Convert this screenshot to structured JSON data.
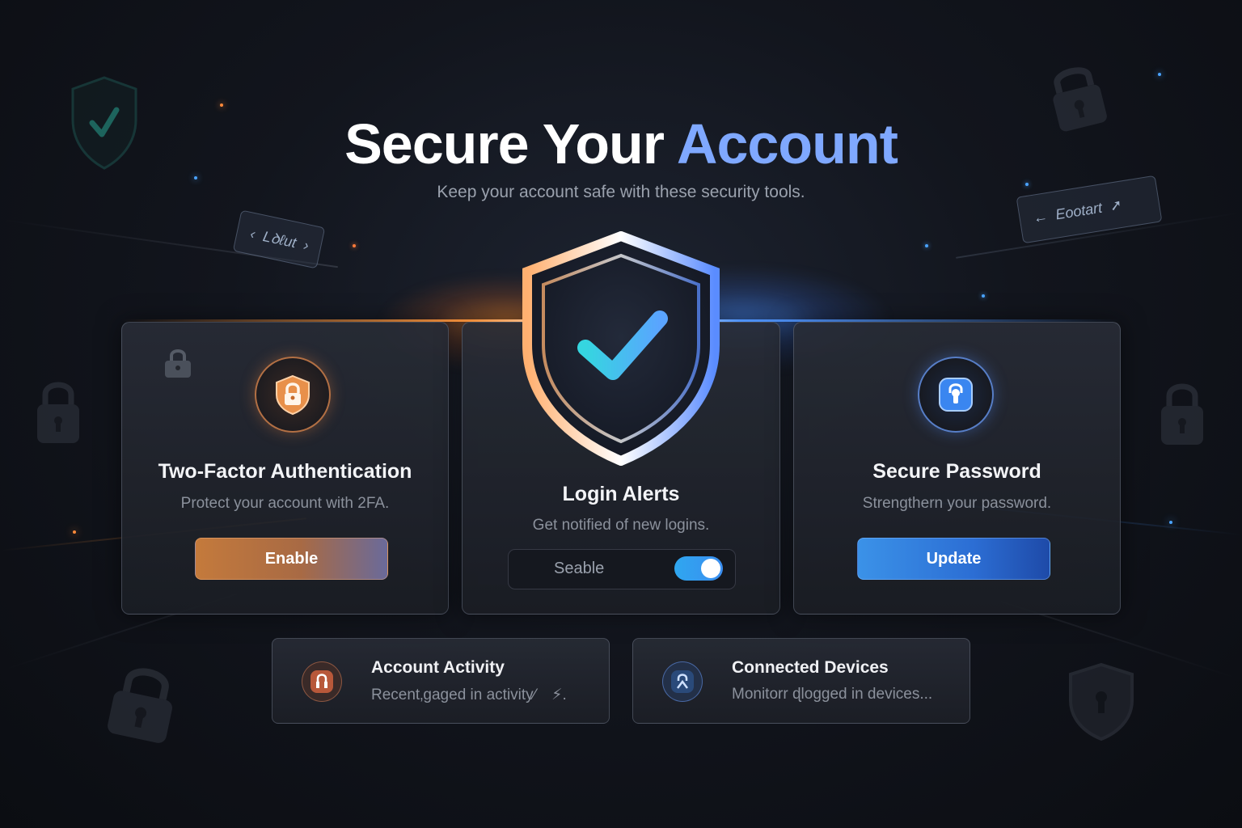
{
  "header": {
    "title_main": "Secure Your",
    "title_accent": "Account",
    "subtitle": "Keep your account safe with these security tools."
  },
  "floating_chips": {
    "left": "Lꝺℓut",
    "right": "Eootart"
  },
  "hero_icon": "shield-check-icon",
  "cards": [
    {
      "icon": "lock-icon",
      "title": "Two-Factor Authentication",
      "description": "Protect your account with 2FA.",
      "button_label": "Enable",
      "accent": "#c47a3c"
    },
    {
      "title": "Login Alerts",
      "description": "Get notified of new logins.",
      "toggle_label": "Seable",
      "toggle_on": true,
      "accent": "#3a8ef0"
    },
    {
      "icon": "keyhole-icon",
      "title": "Secure Password",
      "description": "Strengthern your password.",
      "button_label": "Update",
      "accent": "#2c6ed4"
    }
  ],
  "mini_cards": [
    {
      "icon": "lock-icon",
      "title": "Account Activity",
      "description": "Recent‚ɡaged in activity⁄",
      "trailing": "⚡."
    },
    {
      "icon": "lock-icon",
      "title": "Connected Devices",
      "description": "Monitorr ɖlogged in devices..."
    }
  ],
  "colors": {
    "accent_blue": "#7fa8ff",
    "accent_orange": "#c47a3c",
    "background": "#0b0d12"
  }
}
